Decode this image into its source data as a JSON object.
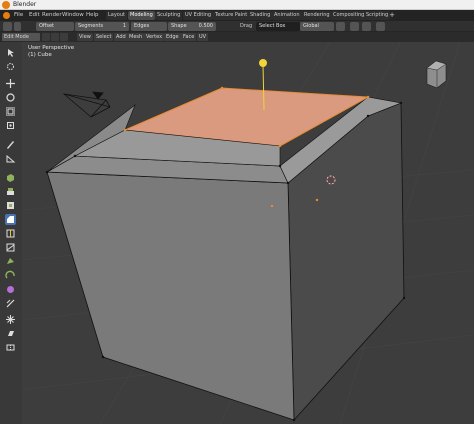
{
  "window": {
    "title": "Blender"
  },
  "menu": [
    "File",
    "Edit",
    "Render",
    "Window",
    "Help"
  ],
  "workspaces": [
    {
      "label": "Layout",
      "active": false
    },
    {
      "label": "Modeling",
      "active": true
    },
    {
      "label": "Sculpting",
      "active": false
    },
    {
      "label": "UV Editing",
      "active": false
    },
    {
      "label": "Texture Paint",
      "active": false
    },
    {
      "label": "Shading",
      "active": false
    },
    {
      "label": "Animation",
      "active": false
    },
    {
      "label": "Rendering",
      "active": false
    },
    {
      "label": "Compositing",
      "active": false
    },
    {
      "label": "Scripting",
      "active": false
    }
  ],
  "tool_settings": {
    "offset_label": "Offset",
    "segments_label": "Segments",
    "segments_value": "1",
    "edges_label": "Edges",
    "shape_label": "Shape",
    "shape_value": "0.500",
    "drag_label": "Drag",
    "select_box_label": "Select Box",
    "orientation_label": "Global"
  },
  "header": {
    "mode": "Edit Mode",
    "menus": [
      "View",
      "Select",
      "Add",
      "Mesh",
      "Vertex",
      "Edge",
      "Face",
      "UV"
    ]
  },
  "viewport": {
    "perspective_label": "User Perspective",
    "object_label": "(1) Cube"
  },
  "colors": {
    "accent": "#4772b3",
    "selected_face": "#d99a80",
    "edge_selected": "#e88a2e",
    "gizmo": "#f2d438"
  }
}
